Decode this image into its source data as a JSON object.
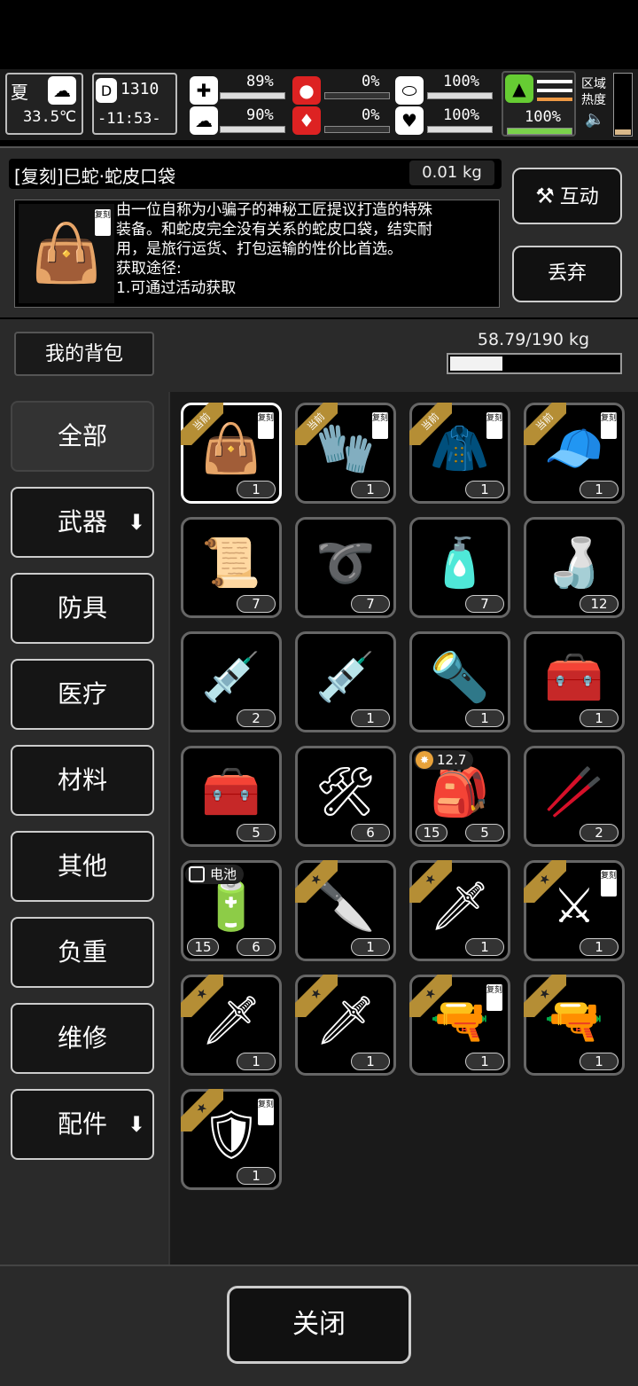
{
  "status": {
    "season": "夏",
    "temperature": "33.5℃",
    "day": "1310",
    "time": "-11:53-",
    "health_pct": "89%",
    "stamina_pct": "90%",
    "hunger_pct": "0%",
    "thirst_pct": "0%",
    "sanity_pct": "100%",
    "mood_pct": "100%",
    "stealth_pct": "100%",
    "zone_heat_label": "区域\n热度"
  },
  "item": {
    "name": "[复刻]巳蛇·蛇皮口袋",
    "weight": "0.01 kg",
    "tag": "复刻",
    "description_lines": [
      "由一位自称为小骗子的神秘工匠提议打造的特殊",
      "装备。和蛇皮完全没有关系的蛇皮口袋，结实耐",
      "用，是旅行运货、打包运输的性价比首选。",
      "获取途径:",
      "1.可通过活动获取"
    ],
    "interact_label": "互动",
    "discard_label": "丢弃"
  },
  "bag": {
    "label": "我的背包",
    "weight_text": "58.79/190 kg",
    "fill_fraction": 0.3094
  },
  "categories": [
    {
      "label": "全部",
      "arrow": "",
      "active": true
    },
    {
      "label": "武器",
      "arrow": "⬇",
      "active": false
    },
    {
      "label": "防具",
      "arrow": "",
      "active": false
    },
    {
      "label": "医疗",
      "arrow": "",
      "active": false
    },
    {
      "label": "材料",
      "arrow": "",
      "active": false
    },
    {
      "label": "其他",
      "arrow": "",
      "active": false
    },
    {
      "label": "负重",
      "arrow": "",
      "active": false
    },
    {
      "label": "维修",
      "arrow": "",
      "active": false
    },
    {
      "label": "配件",
      "arrow": "⬇",
      "active": false
    }
  ],
  "items": [
    {
      "icon": "bag-icon",
      "glyph": "👜",
      "count": "1",
      "ribbon": "当前",
      "tag": "复刻",
      "selected": true
    },
    {
      "icon": "gloves-icon",
      "glyph": "🧤",
      "count": "1",
      "ribbon": "当前",
      "tag": "复刻"
    },
    {
      "icon": "coat-icon",
      "glyph": "🧥",
      "count": "1",
      "ribbon": "当前",
      "tag": "复刻"
    },
    {
      "icon": "cap-icon",
      "glyph": "🧢",
      "count": "1",
      "ribbon": "当前",
      "tag": "复刻"
    },
    {
      "icon": "cloth-roll-icon",
      "glyph": "📜",
      "count": "7"
    },
    {
      "icon": "rope-icon",
      "glyph": "➰",
      "count": "7"
    },
    {
      "icon": "bottles-icon",
      "glyph": "🧴",
      "count": "7"
    },
    {
      "icon": "water-bottle-icon",
      "glyph": "🍶",
      "count": "12"
    },
    {
      "icon": "syringe-icon",
      "glyph": "💉",
      "count": "2"
    },
    {
      "icon": "adrenaline-syringe-icon",
      "glyph": "💉",
      "count": "1"
    },
    {
      "icon": "flashlight-icon",
      "glyph": "🔦",
      "count": "1"
    },
    {
      "icon": "toolbox-icon",
      "glyph": "🧰",
      "count": "1"
    },
    {
      "icon": "tool-kit-icon",
      "glyph": "🧰",
      "count": "5"
    },
    {
      "icon": "tool-bag-icon",
      "glyph": "🛠",
      "count": "6"
    },
    {
      "icon": "ammo-pouch-icon",
      "glyph": "🎒",
      "count": "5",
      "count2": "15",
      "badge": "12.7"
    },
    {
      "icon": "rod-icon",
      "glyph": "🥢",
      "count": "2"
    },
    {
      "icon": "battery-pack-icon",
      "glyph": "🔋",
      "count": "6",
      "count2": "15",
      "battery": "电池"
    },
    {
      "icon": "knife-icon",
      "glyph": "🔪",
      "count": "1",
      "ribbon": "★"
    },
    {
      "icon": "katana-icon",
      "glyph": "🗡",
      "count": "1",
      "ribbon": "★"
    },
    {
      "icon": "long-sword-icon",
      "glyph": "⚔",
      "count": "1",
      "ribbon": "★",
      "tag": "复刻"
    },
    {
      "icon": "chain-blade-icon",
      "glyph": "🗡",
      "count": "1",
      "ribbon": "★"
    },
    {
      "icon": "curved-sword-icon",
      "glyph": "🗡",
      "count": "1",
      "ribbon": "★"
    },
    {
      "icon": "sniper-rifle-icon",
      "glyph": "🔫",
      "count": "1",
      "ribbon": "★",
      "tag": "复刻"
    },
    {
      "icon": "assault-rifle-icon",
      "glyph": "🔫",
      "count": "1",
      "ribbon": "★"
    },
    {
      "icon": "armor-icon",
      "glyph": "🛡",
      "count": "1",
      "ribbon": "★",
      "tag": "复刻"
    }
  ],
  "footer": {
    "close_label": "关闭"
  }
}
